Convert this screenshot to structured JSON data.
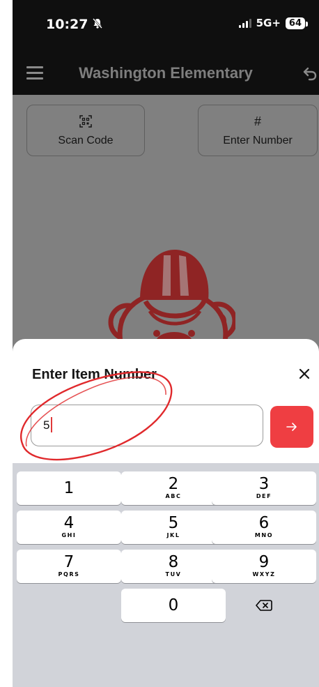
{
  "status_bar": {
    "time": "10:27",
    "network": "5G+",
    "battery": "64"
  },
  "header": {
    "title": "Washington Elementary"
  },
  "actions": {
    "scan_label": "Scan Code",
    "number_icon": "#",
    "number_label": "Enter Number"
  },
  "sheet": {
    "title": "Enter Item Number",
    "input_value": "5"
  },
  "keypad": {
    "keys": [
      {
        "digit": "1",
        "letters": ""
      },
      {
        "digit": "2",
        "letters": "ABC"
      },
      {
        "digit": "3",
        "letters": "DEF"
      },
      {
        "digit": "4",
        "letters": "GHI"
      },
      {
        "digit": "5",
        "letters": "JKL"
      },
      {
        "digit": "6",
        "letters": "MNO"
      },
      {
        "digit": "7",
        "letters": "PQRS"
      },
      {
        "digit": "8",
        "letters": "TUV"
      },
      {
        "digit": "9",
        "letters": "WXYZ"
      },
      {
        "digit": "0",
        "letters": ""
      }
    ]
  },
  "colors": {
    "accent": "#ef3e42",
    "mascot": "#8f2424",
    "overlay": "#808080",
    "keypad_bg": "#d1d3d9",
    "annotation": "#e0292c"
  },
  "icons": [
    "bell-slash-icon",
    "signal-icon",
    "battery-icon",
    "menu-icon",
    "back-icon",
    "qr-scan-icon",
    "hash-icon",
    "mascot-logo",
    "close-icon",
    "arrow-right-icon",
    "backspace-icon"
  ]
}
